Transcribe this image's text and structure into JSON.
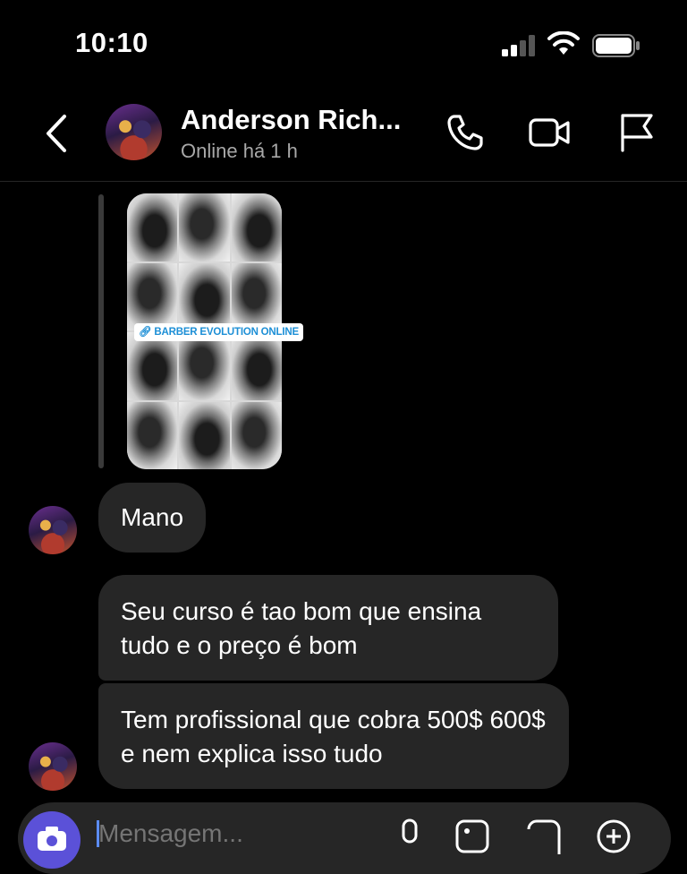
{
  "status_bar": {
    "time": "10:10"
  },
  "header": {
    "contact_name": "Anderson Rich...",
    "status": "Online há 1 h"
  },
  "shared_story": {
    "link_label": "BARBER EVOLUTION ONLINE"
  },
  "messages": [
    {
      "text": "Mano"
    },
    {
      "text": "Seu curso é tao bom que ensina tudo e o preço é bom"
    },
    {
      "text": "Tem profissional que cobra 500$ 600$ e nem explica isso tudo"
    }
  ],
  "composer": {
    "placeholder": "Mensagem..."
  },
  "colors": {
    "background": "#000000",
    "bubble": "#262626",
    "accent": "#5b51d8",
    "link": "#1d8fd6"
  }
}
